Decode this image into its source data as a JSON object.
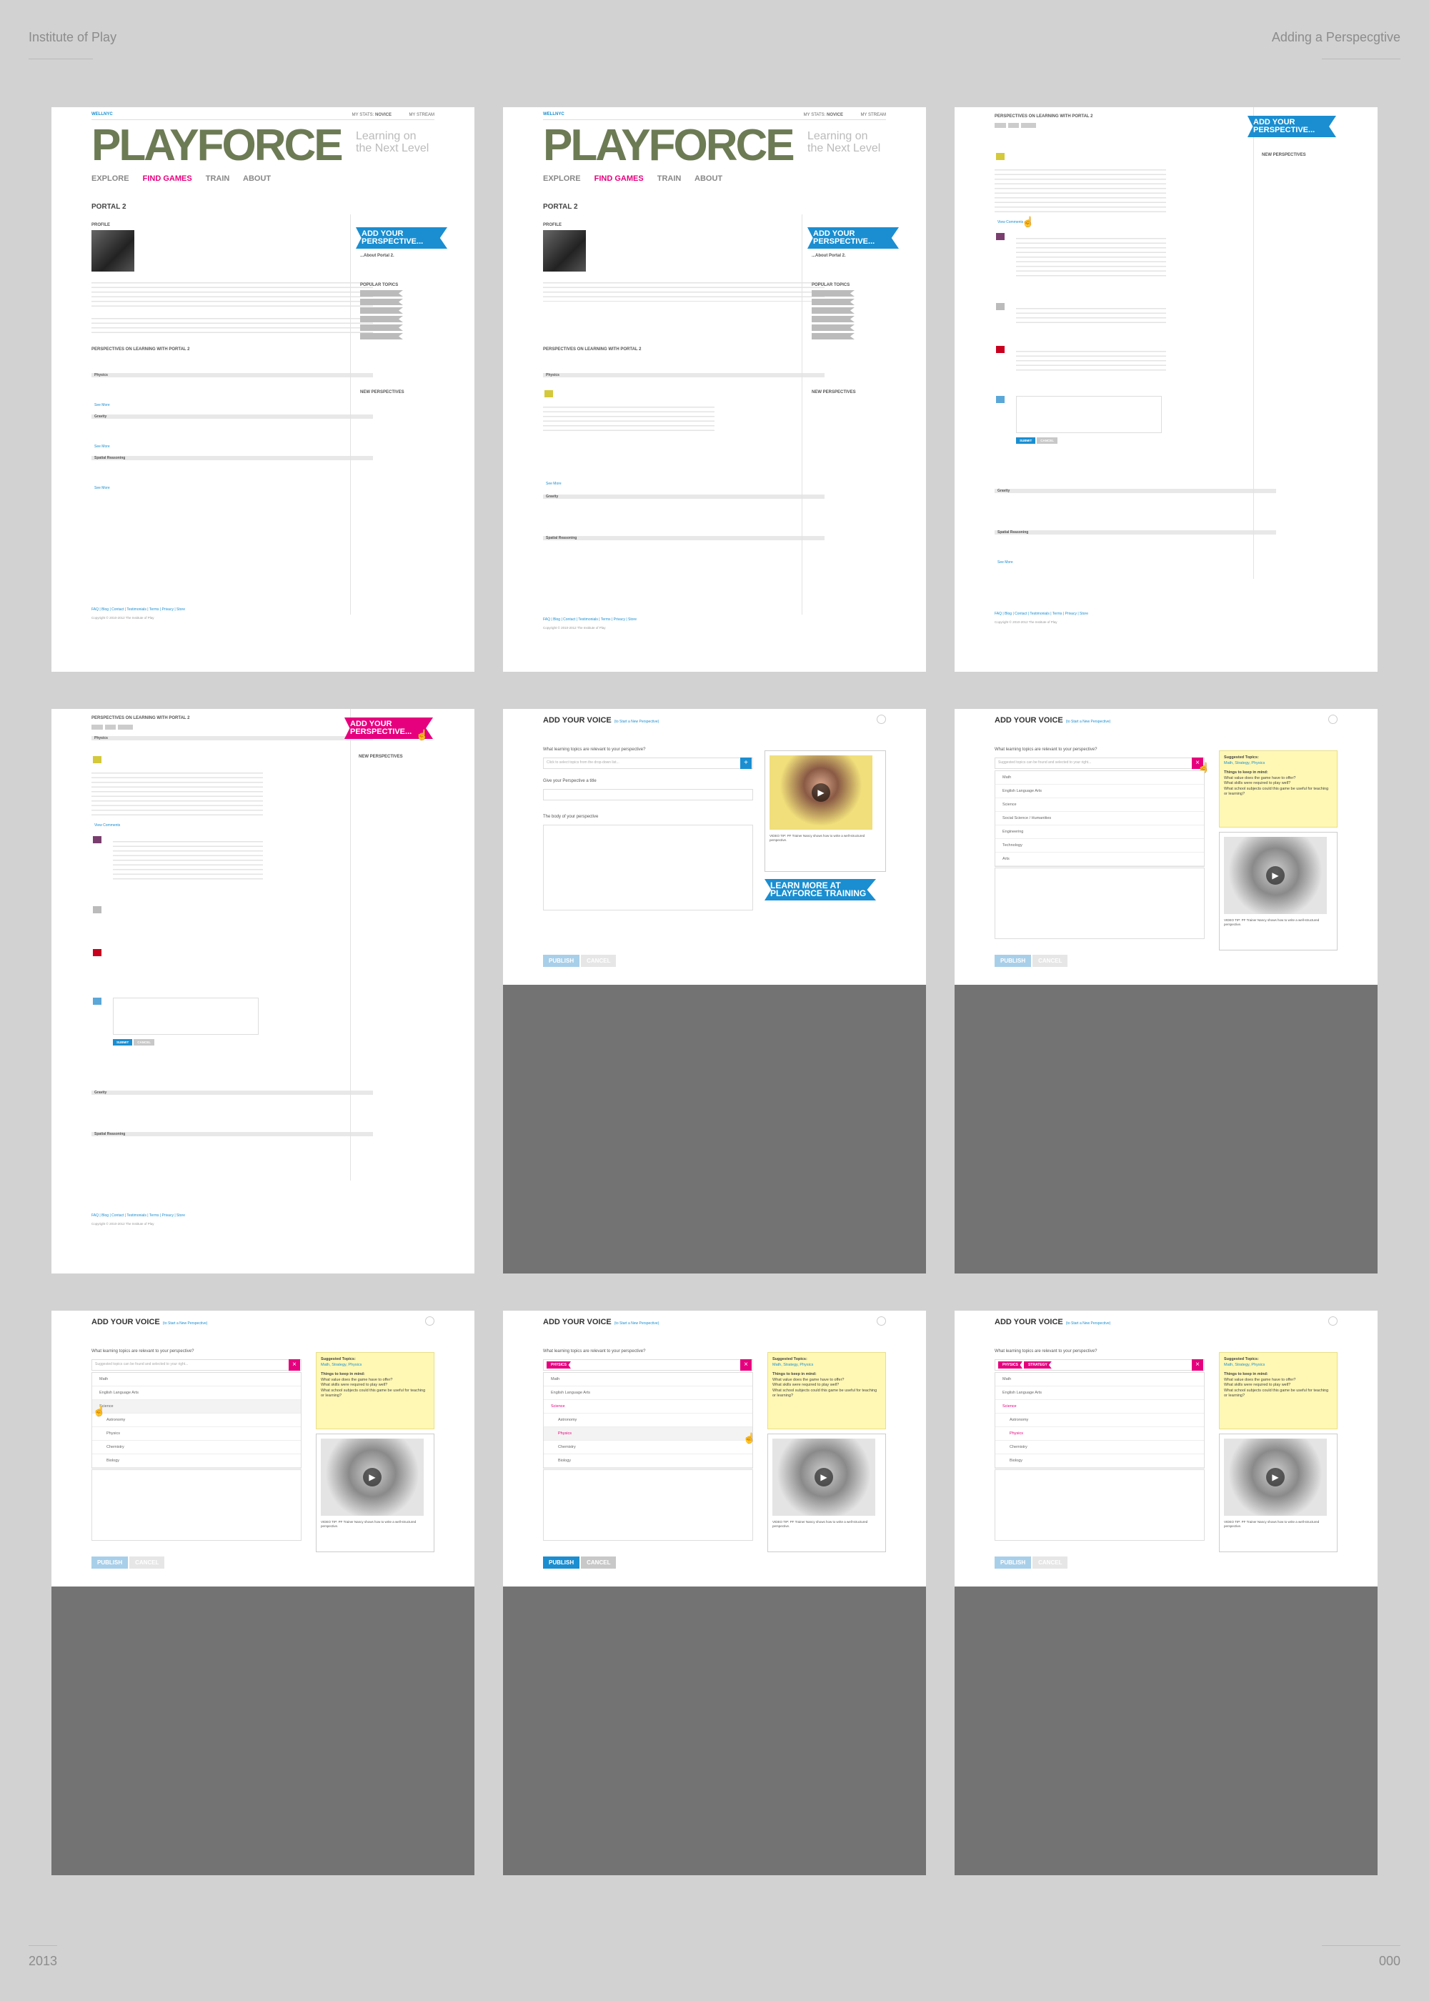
{
  "sheet": {
    "org": "Institute of Play",
    "title": "Adding a Perspecgtive",
    "year": "2013",
    "page": "000"
  },
  "site": {
    "brand": "WELLNYC",
    "stats_label": "MY STATS:",
    "level": "NOVICE",
    "my_stream": "MY STREAM",
    "logo_word": "PLAYFORCE",
    "tagline": "Learning on the Next Level",
    "nav": [
      "EXPLORE",
      "FIND GAMES",
      "TRAIN",
      "ABOUT"
    ],
    "game_title": "PORTAL 2",
    "profile_label": "PROFILE",
    "perspectives_heading": "PERSPECTIVES ON LEARNING WITH PORTAL 2",
    "add_cta": "ADD YOUR PERSPECTIVE...",
    "about_portal": "...About Portal 2.",
    "popular_topics": "POPULAR TOPICS",
    "new_perspectives": "NEW PERSPECTIVES",
    "groups": [
      "Physics",
      "Gravity",
      "Spatial Reasoning"
    ],
    "see_more": "See More",
    "view_comments": "View Comments",
    "footer_links": "FAQ | Blog | Contact | Testimonials | Terms | Privacy | Store",
    "copyright": "Copyright © 2010-2012 The Institute of Play",
    "submit": "SUBMIT",
    "cancel_small": "CANCEL"
  },
  "modal": {
    "title": "ADD YOUR VOICE",
    "subtitle": "(to Start a New Perspective)",
    "q_topics": "What learning topics are relevant to your perspective?",
    "topics_placeholder_1": "Click to select topics from the drop-down list...",
    "topics_placeholder_2": "Suggested topics can be found and selected to your right...",
    "q_title": "Give your Perspective a title",
    "q_body": "The body of your perspective",
    "learn_more": "LEARN MORE AT PLAYFORCE TRAINING",
    "video_tip": "VIDEO TIP: PF Trainer Nancy shows how to write a well-structured perspective.",
    "tips_heading": "Suggested Topics:",
    "suggested": "Math, Strategy, Physics",
    "things_heading": "Things to keep in mind:",
    "things": [
      "What value does the game have to offer?",
      "What skills were required to play well?",
      "What school subjects could this game be useful for teaching or learning?"
    ],
    "dropdown": [
      "Math",
      "English Language Arts",
      "Science",
      "Social Science / Humanities",
      "Engineering",
      "Technology",
      "Arts"
    ],
    "science_sub": [
      "Astronomy",
      "Physics",
      "Chemistry",
      "Biology"
    ],
    "chips": [
      "PHYSICS",
      "STRATEGY"
    ],
    "publish": "PUBLISH",
    "cancel": "CANCEL"
  },
  "colors": {
    "background": "#d2d2d2",
    "accent_blue": "#1a8ed1",
    "accent_pink": "#e6007e",
    "note_yellow": "#fff8b5"
  },
  "icons": [
    "play-icon",
    "close-icon",
    "cursor-icon",
    "plus-icon",
    "x-icon"
  ]
}
